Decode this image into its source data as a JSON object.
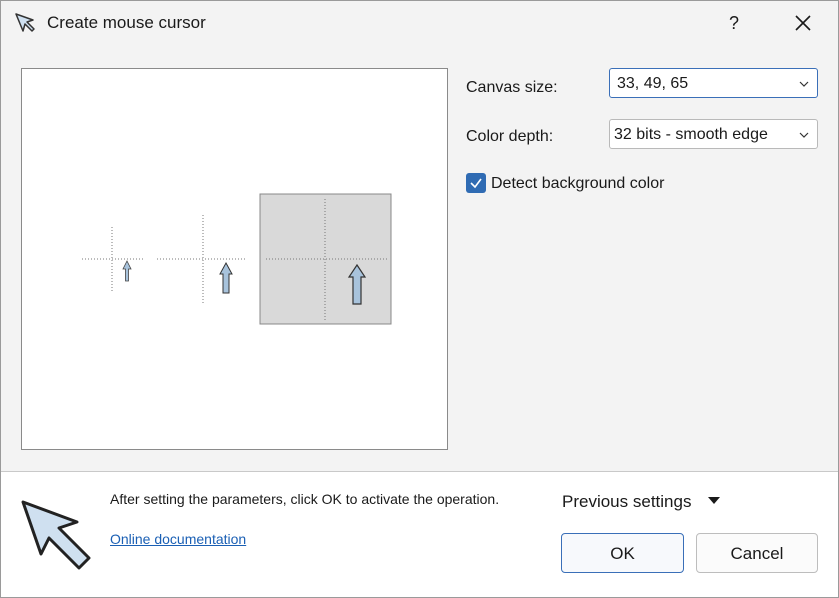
{
  "titlebar": {
    "title": "Create mouse cursor",
    "help": "?"
  },
  "form": {
    "canvas_size_label": "Canvas size:",
    "canvas_size_value": "33, 49, 65",
    "color_depth_label": "Color depth:",
    "color_depth_value": "32 bits - smooth edge",
    "detect_bg_label": "Detect background color",
    "detect_bg_checked": true
  },
  "footer": {
    "hint": "After setting the parameters, click OK to activate the operation.",
    "doc_link": "Online documentation",
    "previous_settings": "Previous settings",
    "ok_label": "OK",
    "cancel_label": "Cancel"
  },
  "icons": [
    "cursor-arrow-icon",
    "close-icon",
    "chevron-down-icon",
    "checkmark-icon",
    "caret-down-icon"
  ],
  "colors": {
    "accent": "#2f6bb3",
    "link": "#1a5fb4",
    "preview_gray": "#d9d9d9"
  }
}
